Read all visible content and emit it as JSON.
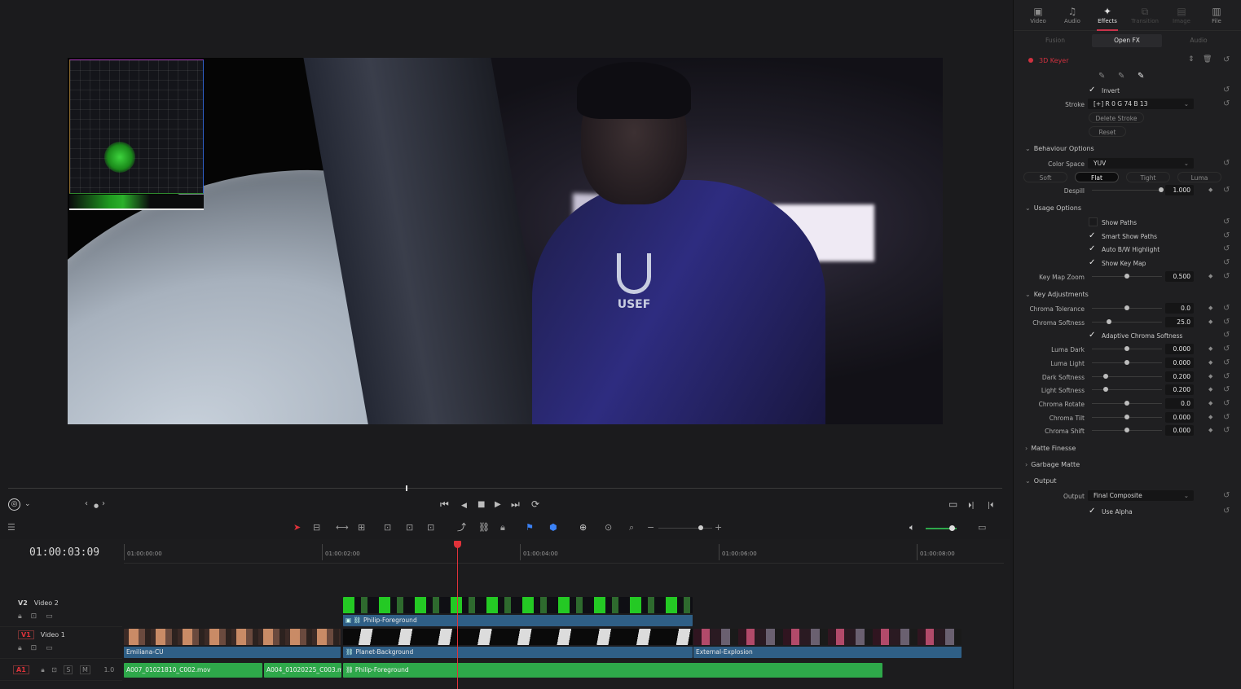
{
  "viewer": {
    "logo_text": "USEF"
  },
  "transport": {
    "workspace_icon": "resolve-logo-icon",
    "nav_prev": "‹",
    "nav_dot": "●",
    "nav_next": "›",
    "first": "⏮",
    "play_reverse": "◀",
    "stop": "■",
    "play": "▶",
    "last": "⏭",
    "loop": "⟳",
    "fullscreen": "▭",
    "next_edit": "⏵|",
    "prev_edit": "|⏴"
  },
  "timeline": {
    "timecode": "01:00:03:09",
    "ruler": [
      "01:00:00:00",
      "01:00:02:00",
      "01:00:04:00",
      "01:00:06:00",
      "01:00:08:00"
    ],
    "tracks": [
      {
        "id": "V2",
        "name": "Video 2"
      },
      {
        "id": "V1",
        "name": "Video 1"
      },
      {
        "id": "A1",
        "name": "",
        "level": "1.0"
      }
    ],
    "clips": {
      "v2_clip": "Philip-Foreground",
      "v1_clip_a": "Emiliana-CU",
      "v1_clip_b": "Planet-Background",
      "v1_clip_c": "External-Explosion",
      "a1_clip_a": "A007_01021810_C002.mov",
      "a1_clip_b": "A004_01020225_C003.m...",
      "a1_clip_c": "Philip-Foreground"
    },
    "track_buttons": {
      "solo": "S",
      "mute": "M"
    }
  },
  "inspector": {
    "tabs": [
      {
        "label": "Video",
        "icon": "video-icon",
        "glyph": "▣",
        "state": "normal"
      },
      {
        "label": "Audio",
        "icon": "audio-icon",
        "glyph": "♫",
        "state": "normal"
      },
      {
        "label": "Effects",
        "icon": "effects-wand-icon",
        "glyph": "✦",
        "state": "active"
      },
      {
        "label": "Transition",
        "icon": "transition-icon",
        "glyph": "⧉",
        "state": "dim"
      },
      {
        "label": "Image",
        "icon": "image-icon",
        "glyph": "▤",
        "state": "dim"
      },
      {
        "label": "File",
        "icon": "file-icon",
        "glyph": "▥",
        "state": "normal"
      }
    ],
    "subtabs": [
      "Fusion",
      "Open FX",
      "Audio"
    ],
    "effect_name": "3D Keyer",
    "invert_label": "Invert",
    "stroke_label": "Stroke",
    "stroke_value": "[+]  R 0  G 74  B 13",
    "delete_stroke": "Delete Stroke",
    "reset": "Reset",
    "behaviour": {
      "title": "Behaviour Options",
      "color_space_label": "Color Space",
      "color_space_value": "YUV",
      "modes": [
        "Soft",
        "Flat",
        "Tight",
        "Luma"
      ],
      "active_mode": "Flat",
      "despill_label": "Despill",
      "despill_value": "1.000",
      "despill_level": 1.0
    },
    "usage": {
      "title": "Usage Options",
      "show_paths": "Show Paths",
      "smart_show_paths": "Smart Show Paths",
      "auto_bw": "Auto B/W Highlight",
      "show_key_map": "Show Key Map",
      "key_map_zoom_label": "Key Map Zoom",
      "key_map_zoom_value": "0.500"
    },
    "key_adjustments": {
      "title": "Key Adjustments",
      "chroma_tolerance_label": "Chroma Tolerance",
      "chroma_tolerance": "0.0",
      "chroma_softness_label": "Chroma Softness",
      "chroma_softness": "25.0",
      "adaptive_label": "Adaptive Chroma Softness",
      "luma_dark_label": "Luma Dark",
      "luma_dark": "0.000",
      "luma_light_label": "Luma Light",
      "luma_light": "0.000",
      "dark_softness_label": "Dark Softness",
      "dark_softness": "0.200",
      "light_softness_label": "Light Softness",
      "light_softness": "0.200",
      "chroma_rotate_label": "Chroma Rotate",
      "chroma_rotate": "0.0",
      "chroma_tilt_label": "Chroma Tilt",
      "chroma_tilt": "0.000",
      "chroma_shift_label": "Chroma Shift",
      "chroma_shift": "0.000"
    },
    "matte_finesse": "Matte Finesse",
    "garbage_matte": "Garbage Matte",
    "output": {
      "title": "Output",
      "output_label": "Output",
      "output_value": "Final Composite",
      "use_alpha": "Use Alpha"
    },
    "colors": {
      "accent": "#c8334a",
      "clip_blue": "#2f5f86",
      "audio_green": "#2ea84a"
    }
  }
}
